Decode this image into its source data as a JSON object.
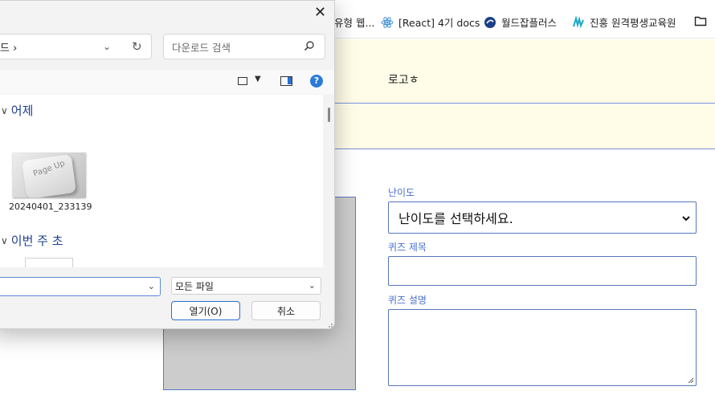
{
  "bookmarks": [
    {
      "label": "유형 웹...",
      "icon": "site-icon"
    },
    {
      "label": "[React] 4기 docs",
      "icon": "react-icon"
    },
    {
      "label": "월드잡플러스",
      "icon": "worldjob-icon"
    },
    {
      "label": "진흥 원격평생교육원",
      "icon": "edu-icon"
    },
    {
      "label": "",
      "icon": "folder-icon"
    }
  ],
  "page": {
    "logo": "로고ㅎ",
    "form": {
      "difficulty_label": "난이도",
      "difficulty_selected": "난이도를 선택하세요.",
      "title_label": "퀴즈 제목",
      "title_value": "",
      "description_label": "퀴즈 설명",
      "description_value": ""
    }
  },
  "dialog": {
    "address": "드 ›",
    "search_placeholder": "다운로드 검색",
    "groups": [
      {
        "label": "어제"
      },
      {
        "label": "이번 주 초"
      }
    ],
    "file": {
      "thumb_text": "Page Up",
      "name": "20240401_233139"
    },
    "filename_value": "",
    "filter_selected": "모든 파일",
    "open_button": "열기(O)",
    "cancel_button": "취소",
    "help_label": "?"
  },
  "colors": {
    "accent": "#2a6fd0",
    "header_bg": "#fffde8",
    "label_blue": "#4a6fd0",
    "group_blue": "#1f3f8f"
  }
}
